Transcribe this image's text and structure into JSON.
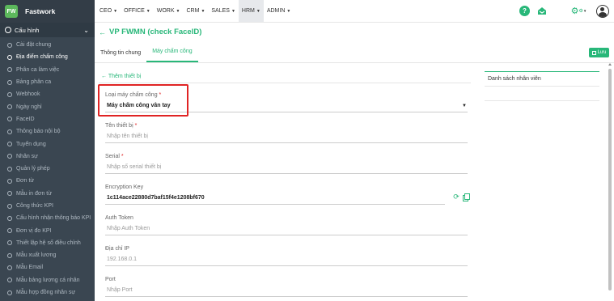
{
  "app": {
    "brand": "Fastwork",
    "logo_text": "FW"
  },
  "sidebar": {
    "section_label": "Cấu hình",
    "items": [
      {
        "label": "Cài đặt chung"
      },
      {
        "label": "Địa điểm chấm công"
      },
      {
        "label": "Phân ca làm việc"
      },
      {
        "label": "Bảng phân ca"
      },
      {
        "label": "Webhook"
      },
      {
        "label": "Ngày nghỉ"
      },
      {
        "label": "FaceID"
      },
      {
        "label": "Thông báo nội bộ"
      },
      {
        "label": "Tuyển dụng"
      },
      {
        "label": "Nhân sự"
      },
      {
        "label": "Quản lý phép"
      },
      {
        "label": "Đơn từ"
      },
      {
        "label": "Mẫu in đơn từ"
      },
      {
        "label": "Công thức KPI"
      },
      {
        "label": "Cấu hình nhận thông báo KPI"
      },
      {
        "label": "Đơn vị đo KPI"
      },
      {
        "label": "Thiết lập hệ số điều chỉnh"
      },
      {
        "label": "Mẫu xuất lương"
      },
      {
        "label": "Mẫu Email"
      },
      {
        "label": "Mẫu bảng lương cá nhân"
      },
      {
        "label": "Mẫu hợp đồng nhân sự"
      }
    ],
    "active_index": 1
  },
  "topnav": {
    "items": [
      {
        "label": "CEO"
      },
      {
        "label": "OFFICE"
      },
      {
        "label": "WORK"
      },
      {
        "label": "CRM"
      },
      {
        "label": "SALES"
      },
      {
        "label": "HRM"
      },
      {
        "label": "ADMIN"
      }
    ],
    "active_index": 5,
    "help_glyph": "?"
  },
  "page": {
    "title": "VP FWMN (check FaceID)",
    "tabs": [
      {
        "label": "Thông tin chung"
      },
      {
        "label": "Máy chấm công"
      }
    ],
    "active_tab": 1,
    "save_label": "Lưu",
    "add_device_label": "Thêm thiết bị"
  },
  "form": {
    "device_type": {
      "label": "Loại máy chấm công",
      "required": "*",
      "value": "Máy chấm công vân tay"
    },
    "device_name": {
      "label": "Tên thiết bị",
      "required": "*",
      "placeholder": "Nhập tên thiết bị"
    },
    "serial": {
      "label": "Serial",
      "required": "*",
      "placeholder": "Nhập số serial thiết bị"
    },
    "encryption_key": {
      "label": "Encryption Key",
      "value": "1c114ace22880d7baf15f4e1208bf670"
    },
    "auth_token": {
      "label": "Auth Token",
      "placeholder": "Nhập Auth Token"
    },
    "ip_address": {
      "label": "Địa chỉ IP",
      "placeholder": "192.168.0.1"
    },
    "port": {
      "label": "Port",
      "placeholder": "Nhập Port"
    }
  },
  "right_panel": {
    "title": "Danh sách nhân viên"
  },
  "colors": {
    "accent": "#28b779",
    "sidebar_bg": "#3a4651",
    "highlight": "#e02424"
  }
}
